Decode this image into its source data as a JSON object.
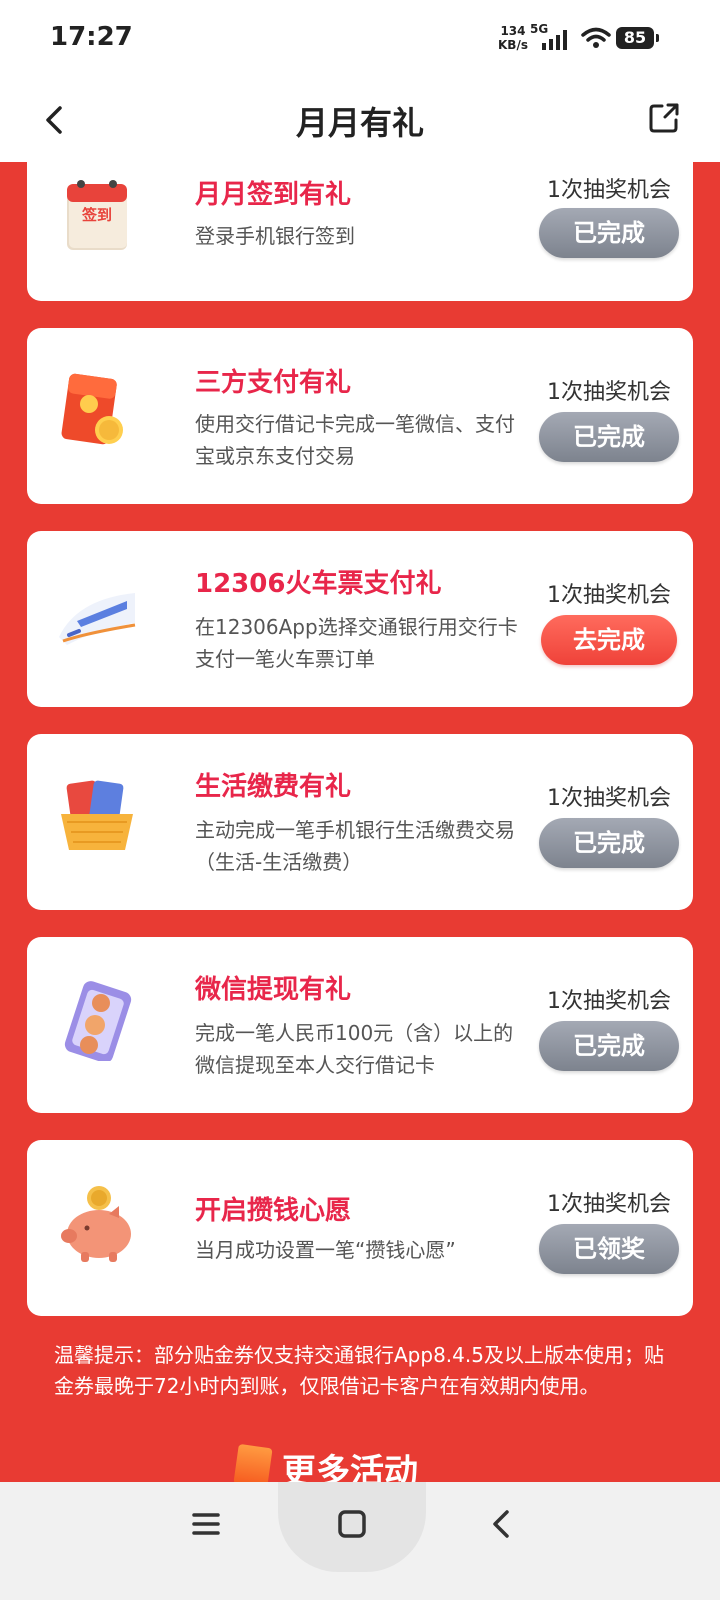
{
  "status_bar": {
    "time": "17:27",
    "network_speed_value": "134",
    "network_speed_unit": "KB/s",
    "network_type": "5G",
    "battery": "85"
  },
  "header": {
    "title": "月月有礼"
  },
  "tasks": [
    {
      "title": "月月签到有礼",
      "desc": "登录手机银行签到",
      "chance": "1次抽奖机会",
      "button": "已完成",
      "icon": "sign-in-calendar-icon",
      "icon_text": "签到"
    },
    {
      "title": "三方支付有礼",
      "desc": "使用交行借记卡完成一笔微信、支付宝或京东支付交易",
      "chance": "1次抽奖机会",
      "button": "已完成",
      "icon": "red-envelope-icon"
    },
    {
      "title": "12306火车票支付礼",
      "desc": "在12306App选择交通银行用交行卡支付一笔火车票订单",
      "chance": "1次抽奖机会",
      "button": "去完成",
      "icon": "high-speed-train-icon"
    },
    {
      "title": "生活缴费有礼",
      "desc": "主动完成一笔手机银行生活缴费交易（生活-生活缴费）",
      "chance": "1次抽奖机会",
      "button": "已完成",
      "icon": "card-basket-icon"
    },
    {
      "title": "微信提现有礼",
      "desc": "完成一笔人民币100元（含）以上的微信提现至本人交行借记卡",
      "chance": "1次抽奖机会",
      "button": "已完成",
      "icon": "phone-coins-icon"
    },
    {
      "title": "开启攒钱心愿",
      "desc": "当月成功设置一笔“攒钱心愿”",
      "chance": "1次抽奖机会",
      "button": "已领奖",
      "icon": "piggy-bank-icon"
    }
  ],
  "tip": "温馨提示：部分贴金券仅支持交通银行App8.4.5及以上版本使用；贴金券最晚于72小时内到账，仅限借记卡客户在有效期内使用。",
  "more": "更多活动",
  "colors": {
    "background_red": "#e83b33",
    "title_red": "#e8264a",
    "button_done_gray": "#8c919c",
    "button_go_red": "#f24a3f"
  }
}
